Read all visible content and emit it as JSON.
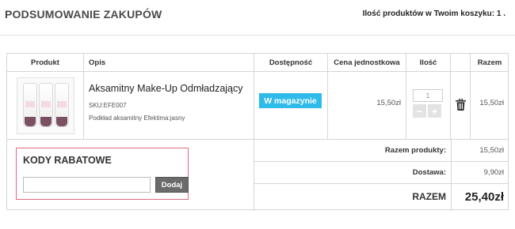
{
  "header": {
    "title": "PODSUMOWANIE ZAKUPÓW",
    "cart_count": "Ilość produktów w Twoim koszyku: 1 ."
  },
  "table": {
    "columns": [
      "Produkt",
      "Opis",
      "Dostępność",
      "Cena jednostkowa",
      "Ilość",
      "",
      "Razem"
    ]
  },
  "item": {
    "name": "Aksamitny Make-Up Odmładzający",
    "sku": "SKU:EFE007",
    "attributes": "Podkład aksamitny Efektima:jasny",
    "availability": "W magazynie",
    "unit_price": "15,50zł",
    "quantity": "1",
    "total": "15,50zł",
    "thumbnail_icon": "product-tubes-image",
    "delete_icon": "trash-icon",
    "minus_label": "−",
    "plus_label": "+"
  },
  "promo": {
    "title": "KODY RABATOWE",
    "input_value": "",
    "button_label": "Dodaj"
  },
  "summary": {
    "products_label": "Razem produkty:",
    "products_value": "15,50zł",
    "shipping_label": "Dostawa:",
    "shipping_value": "9,90zł",
    "total_label": "RAZEM",
    "total_value": "25,40zł"
  },
  "colors": {
    "stock_badge": "#2fbbea",
    "promo_border": "#e06a80",
    "button_bg": "#6b6b6b"
  }
}
